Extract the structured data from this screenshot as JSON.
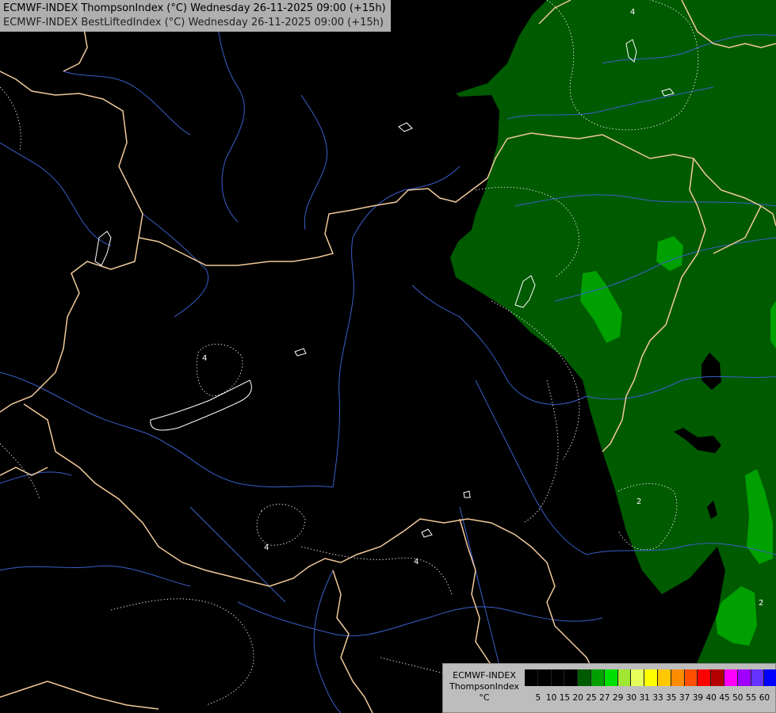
{
  "header": {
    "line1": "ECMWF-INDEX ThompsonIndex (°C) Wednesday 26-11-2025 09:00 (+15h)",
    "line2": "ECMWF-INDEX BestLiftedIndex (°C) Wednesday 26-11-2025 09:00 (+15h)"
  },
  "map": {
    "contour_labels": [
      "4",
      "4",
      "4",
      "2",
      "2",
      "4"
    ]
  },
  "legend": {
    "title_line1": "ECMWF-INDEX",
    "title_line2": "ThompsonIndex",
    "unit": "°C",
    "ticks": [
      "5",
      "10",
      "15",
      "20",
      "25",
      "27",
      "29",
      "30",
      "31",
      "33",
      "35",
      "37",
      "39",
      "40",
      "45",
      "50",
      "55",
      "60"
    ],
    "colors": [
      "#000000",
      "#000000",
      "#000000",
      "#000000",
      "#005a00",
      "#00a000",
      "#00e000",
      "#a0e632",
      "#e6ff5a",
      "#ffff00",
      "#ffc800",
      "#ff8c00",
      "#ff5000",
      "#ff0000",
      "#b40000",
      "#ff00ff",
      "#a000ff",
      "#6432ff",
      "#0000ff"
    ]
  }
}
